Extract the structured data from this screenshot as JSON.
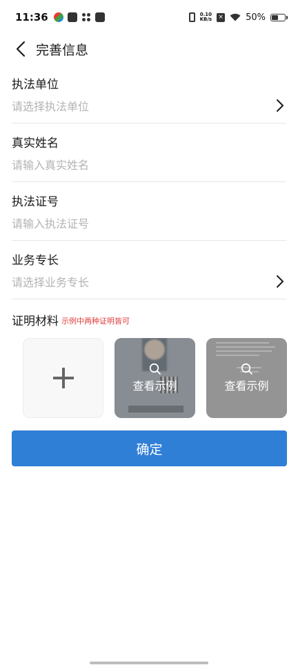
{
  "status_bar": {
    "time": "11:36",
    "net_speed_value": "0.10",
    "net_speed_unit": "KB/s",
    "battery": "50%",
    "battery_level": 0.5,
    "icons": [
      "app-notification-icon",
      "mail-icon",
      "grid-app-icon",
      "message-icon",
      "vibrate-icon",
      "sim-off-icon",
      "wifi-icon",
      "battery-icon"
    ]
  },
  "header": {
    "title": "完善信息",
    "back_icon": "chevron-left-icon"
  },
  "form": {
    "fields": [
      {
        "label": "执法单位",
        "placeholder": "请选择执法单位",
        "type": "select"
      },
      {
        "label": "真实姓名",
        "placeholder": "请输入真实姓名",
        "type": "text"
      },
      {
        "label": "执法证号",
        "placeholder": "请输入执法证号",
        "type": "text"
      },
      {
        "label": "业务专长",
        "placeholder": "请选择业务专长",
        "type": "select"
      }
    ],
    "proof": {
      "label": "证明材料",
      "hint": "示例中两种证明皆可",
      "add_icon": "plus-icon",
      "examples": [
        {
          "label": "查看示例",
          "icon": "search-icon"
        },
        {
          "label": "查看示例",
          "icon": "search-icon"
        }
      ]
    }
  },
  "confirm_label": "确定",
  "colors": {
    "primary": "#2f7fd6",
    "hint_red": "#e03a3a",
    "placeholder": "#b3b3b3",
    "divider": "#e6e6e6"
  }
}
